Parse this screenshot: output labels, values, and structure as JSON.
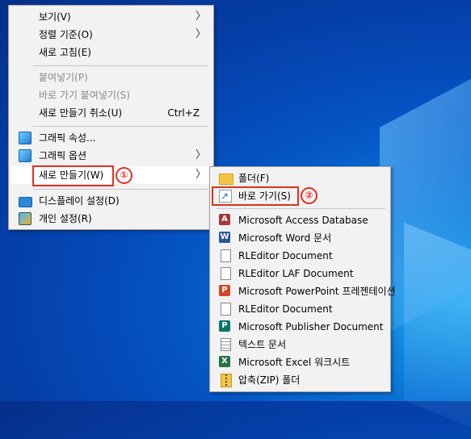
{
  "desktop_menu": {
    "items": [
      {
        "label": "보기(V)",
        "submenu": true
      },
      {
        "label": "정렬 기준(O)",
        "submenu": true
      },
      {
        "label": "새로 고침(E)"
      },
      {
        "label": "붙여넣기(P)",
        "disabled": true
      },
      {
        "label": "바로 가기 붙여넣기(S)",
        "disabled": true
      },
      {
        "label": "새로 만들기 취소(U)",
        "shortcut": "Ctrl+Z"
      },
      {
        "label": "그래픽 속성..."
      },
      {
        "label": "그래픽 옵션",
        "submenu": true
      },
      {
        "label": "새로 만들기(W)",
        "submenu": true,
        "highlighted": true
      },
      {
        "label": "디스플레이 설정(D)"
      },
      {
        "label": "개인 설정(R)"
      }
    ]
  },
  "new_submenu": {
    "items": [
      {
        "label": "폴더(F)",
        "icon": "folder-icon"
      },
      {
        "label": "바로 가기(S)",
        "icon": "shortcut-icon"
      },
      {
        "label": "Microsoft Access Database",
        "icon": "access-icon"
      },
      {
        "label": "Microsoft Word 문서",
        "icon": "word-icon"
      },
      {
        "label": "RLEditor Document",
        "icon": "document-icon"
      },
      {
        "label": "RLEditor LAF Document",
        "icon": "document-icon"
      },
      {
        "label": "Microsoft PowerPoint 프레젠테이션",
        "icon": "powerpoint-icon"
      },
      {
        "label": "RLEditor Document",
        "icon": "document-icon"
      },
      {
        "label": "Microsoft Publisher Document",
        "icon": "publisher-icon"
      },
      {
        "label": "텍스트 문서",
        "icon": "text-document-icon"
      },
      {
        "label": "Microsoft Excel 워크시트",
        "icon": "excel-icon"
      },
      {
        "label": "압축(ZIP) 폴더",
        "icon": "zip-folder-icon"
      }
    ]
  },
  "icon_letters": {
    "access": "A",
    "word": "W",
    "powerpoint": "P",
    "publisher": "P",
    "excel": "X"
  },
  "annotations": {
    "step1": "①",
    "step2": "②"
  },
  "arrow_glyph": "〉",
  "colors": {
    "annotation_red": "#e0301e",
    "menu_bg": "#f2f2f2",
    "desktop_blue": "#0553c4"
  }
}
